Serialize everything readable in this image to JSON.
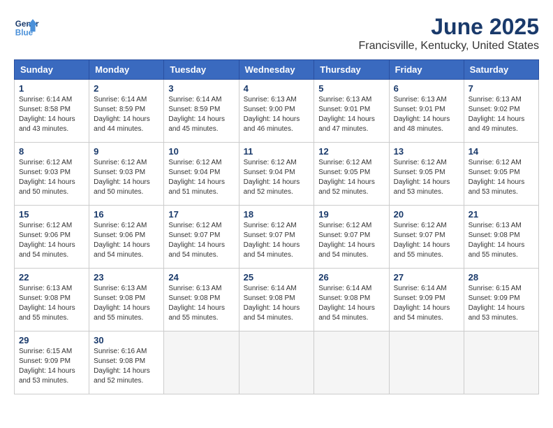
{
  "logo": {
    "line1": "General",
    "line2": "Blue"
  },
  "title": "June 2025",
  "location": "Francisville, Kentucky, United States",
  "weekdays": [
    "Sunday",
    "Monday",
    "Tuesday",
    "Wednesday",
    "Thursday",
    "Friday",
    "Saturday"
  ],
  "weeks": [
    [
      {
        "day": "1",
        "sunrise": "6:14 AM",
        "sunset": "8:58 PM",
        "daylight": "14 hours and 43 minutes."
      },
      {
        "day": "2",
        "sunrise": "6:14 AM",
        "sunset": "8:59 PM",
        "daylight": "14 hours and 44 minutes."
      },
      {
        "day": "3",
        "sunrise": "6:14 AM",
        "sunset": "8:59 PM",
        "daylight": "14 hours and 45 minutes."
      },
      {
        "day": "4",
        "sunrise": "6:13 AM",
        "sunset": "9:00 PM",
        "daylight": "14 hours and 46 minutes."
      },
      {
        "day": "5",
        "sunrise": "6:13 AM",
        "sunset": "9:01 PM",
        "daylight": "14 hours and 47 minutes."
      },
      {
        "day": "6",
        "sunrise": "6:13 AM",
        "sunset": "9:01 PM",
        "daylight": "14 hours and 48 minutes."
      },
      {
        "day": "7",
        "sunrise": "6:13 AM",
        "sunset": "9:02 PM",
        "daylight": "14 hours and 49 minutes."
      }
    ],
    [
      {
        "day": "8",
        "sunrise": "6:12 AM",
        "sunset": "9:03 PM",
        "daylight": "14 hours and 50 minutes."
      },
      {
        "day": "9",
        "sunrise": "6:12 AM",
        "sunset": "9:03 PM",
        "daylight": "14 hours and 50 minutes."
      },
      {
        "day": "10",
        "sunrise": "6:12 AM",
        "sunset": "9:04 PM",
        "daylight": "14 hours and 51 minutes."
      },
      {
        "day": "11",
        "sunrise": "6:12 AM",
        "sunset": "9:04 PM",
        "daylight": "14 hours and 52 minutes."
      },
      {
        "day": "12",
        "sunrise": "6:12 AM",
        "sunset": "9:05 PM",
        "daylight": "14 hours and 52 minutes."
      },
      {
        "day": "13",
        "sunrise": "6:12 AM",
        "sunset": "9:05 PM",
        "daylight": "14 hours and 53 minutes."
      },
      {
        "day": "14",
        "sunrise": "6:12 AM",
        "sunset": "9:05 PM",
        "daylight": "14 hours and 53 minutes."
      }
    ],
    [
      {
        "day": "15",
        "sunrise": "6:12 AM",
        "sunset": "9:06 PM",
        "daylight": "14 hours and 54 minutes."
      },
      {
        "day": "16",
        "sunrise": "6:12 AM",
        "sunset": "9:06 PM",
        "daylight": "14 hours and 54 minutes."
      },
      {
        "day": "17",
        "sunrise": "6:12 AM",
        "sunset": "9:07 PM",
        "daylight": "14 hours and 54 minutes."
      },
      {
        "day": "18",
        "sunrise": "6:12 AM",
        "sunset": "9:07 PM",
        "daylight": "14 hours and 54 minutes."
      },
      {
        "day": "19",
        "sunrise": "6:12 AM",
        "sunset": "9:07 PM",
        "daylight": "14 hours and 54 minutes."
      },
      {
        "day": "20",
        "sunrise": "6:12 AM",
        "sunset": "9:07 PM",
        "daylight": "14 hours and 55 minutes."
      },
      {
        "day": "21",
        "sunrise": "6:13 AM",
        "sunset": "9:08 PM",
        "daylight": "14 hours and 55 minutes."
      }
    ],
    [
      {
        "day": "22",
        "sunrise": "6:13 AM",
        "sunset": "9:08 PM",
        "daylight": "14 hours and 55 minutes."
      },
      {
        "day": "23",
        "sunrise": "6:13 AM",
        "sunset": "9:08 PM",
        "daylight": "14 hours and 55 minutes."
      },
      {
        "day": "24",
        "sunrise": "6:13 AM",
        "sunset": "9:08 PM",
        "daylight": "14 hours and 55 minutes."
      },
      {
        "day": "25",
        "sunrise": "6:14 AM",
        "sunset": "9:08 PM",
        "daylight": "14 hours and 54 minutes."
      },
      {
        "day": "26",
        "sunrise": "6:14 AM",
        "sunset": "9:08 PM",
        "daylight": "14 hours and 54 minutes."
      },
      {
        "day": "27",
        "sunrise": "6:14 AM",
        "sunset": "9:09 PM",
        "daylight": "14 hours and 54 minutes."
      },
      {
        "day": "28",
        "sunrise": "6:15 AM",
        "sunset": "9:09 PM",
        "daylight": "14 hours and 53 minutes."
      }
    ],
    [
      {
        "day": "29",
        "sunrise": "6:15 AM",
        "sunset": "9:09 PM",
        "daylight": "14 hours and 53 minutes."
      },
      {
        "day": "30",
        "sunrise": "6:16 AM",
        "sunset": "9:08 PM",
        "daylight": "14 hours and 52 minutes."
      },
      null,
      null,
      null,
      null,
      null
    ]
  ]
}
